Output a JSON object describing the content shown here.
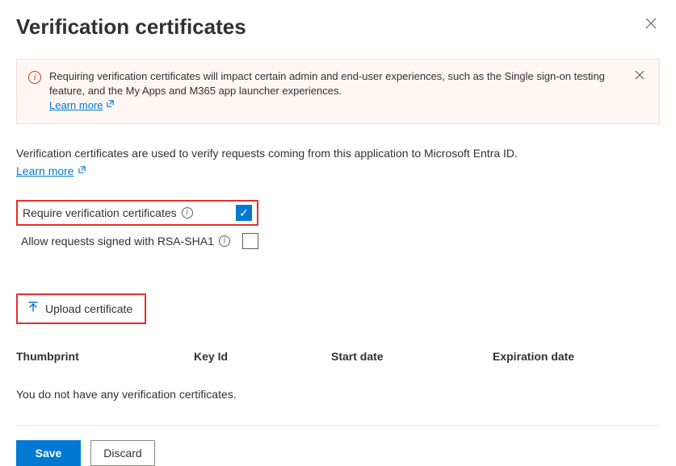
{
  "header": {
    "title": "Verification certificates"
  },
  "notice": {
    "text": "Requiring verification certificates will impact certain admin and end-user experiences, such as the Single sign-on testing feature, and the My Apps and M365 app launcher experiences.",
    "learn_more": "Learn more"
  },
  "intro": {
    "text": "Verification certificates are used to verify requests coming from this application to Microsoft Entra ID.",
    "learn_more": "Learn more"
  },
  "settings": {
    "require_label": "Require verification certificates",
    "require_checked": true,
    "rsa_label": "Allow requests signed with RSA-SHA1",
    "rsa_checked": false
  },
  "upload": {
    "label": "Upload certificate"
  },
  "table": {
    "columns": {
      "thumbprint": "Thumbprint",
      "key_id": "Key Id",
      "start_date": "Start date",
      "expiration_date": "Expiration date"
    },
    "empty_message": "You do not have any verification certificates."
  },
  "footer": {
    "save": "Save",
    "discard": "Discard"
  }
}
